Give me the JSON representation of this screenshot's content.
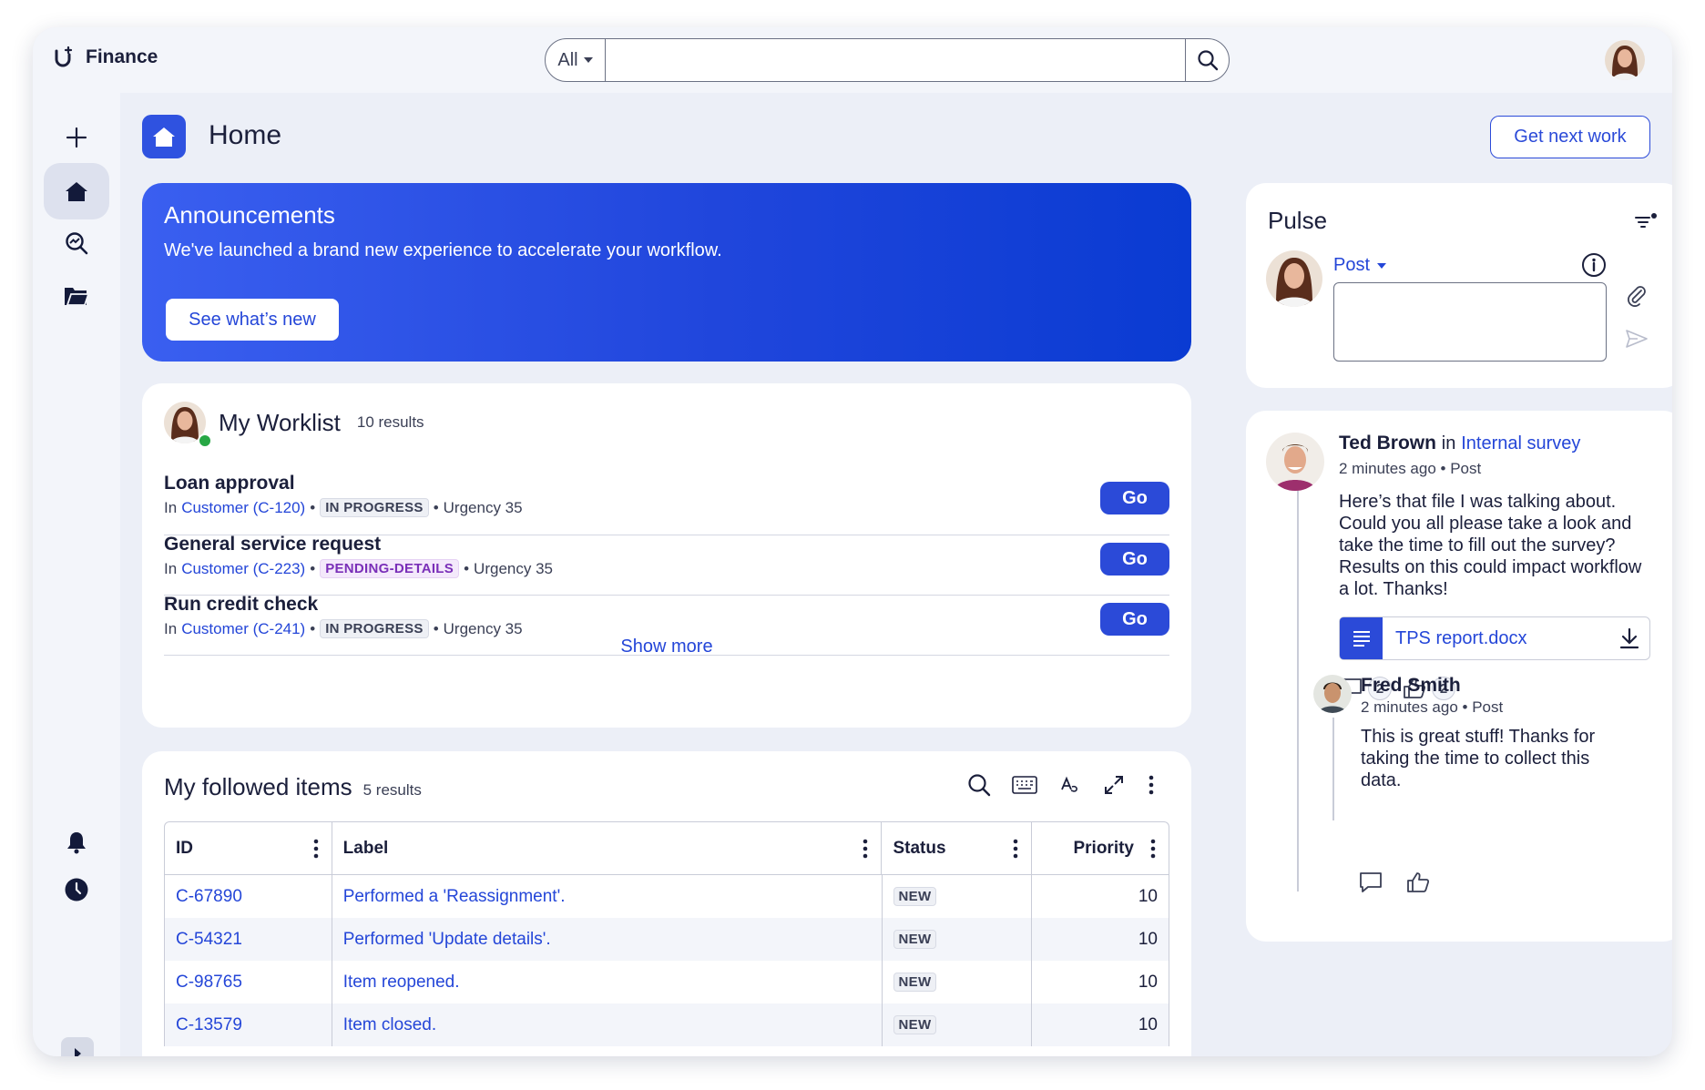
{
  "app": {
    "name": "Finance"
  },
  "search": {
    "scope": "All",
    "value": "",
    "placeholder": ""
  },
  "page": {
    "title": "Home",
    "action_label": "Get next work"
  },
  "announcement": {
    "title": "Announcements",
    "text": "We've launched a brand new experience to accelerate your workflow.",
    "button": "See what’s new"
  },
  "worklist": {
    "title": "My Worklist",
    "count": "10 results",
    "items": [
      {
        "title": "Loan approval",
        "prefix": "In",
        "ref": "Customer (C-120)",
        "status": "IN PROGRESS",
        "urgency": "Urgency 35",
        "action": "Go"
      },
      {
        "title": "General service request",
        "prefix": "In",
        "ref": "Customer (C-223)",
        "status": "PENDING-DETAILS",
        "urgency": "Urgency 35",
        "action": "Go"
      },
      {
        "title": "Run credit check",
        "prefix": "In",
        "ref": "Customer (C-241)",
        "status": "IN PROGRESS",
        "urgency": "Urgency 35",
        "action": "Go"
      }
    ],
    "show_more": "Show more"
  },
  "followed": {
    "title": "My followed items",
    "count": "5 results",
    "columns": [
      "ID",
      "Label",
      "Status",
      "Priority"
    ],
    "rows": [
      {
        "id": "C-67890",
        "label": "Performed a 'Reassignment'.",
        "status": "NEW",
        "priority": "10"
      },
      {
        "id": "C-54321",
        "label": "Performed 'Update details'.",
        "status": "NEW",
        "priority": "10"
      },
      {
        "id": "C-98765",
        "label": "Item reopened.",
        "status": "NEW",
        "priority": "10"
      },
      {
        "id": "C-13579",
        "label": "Item closed.",
        "status": "NEW",
        "priority": "10"
      }
    ]
  },
  "pulse": {
    "title": "Pulse",
    "post_type": "Post",
    "post_value": ""
  },
  "feed": {
    "post": {
      "author": "Ted Brown",
      "in": "in",
      "channel": "Internal survey",
      "meta": "2 minutes ago • Post",
      "body": "Here’s that file I was talking about. Could you all please take a look and take the time to fill out the survey? Results on this could impact workflow a lot. Thanks!",
      "attachment": "TPS report.docx",
      "comment_count": "2",
      "like_count": "2"
    },
    "reply": {
      "author": "Fred Smith",
      "meta": "2 minutes ago • Post",
      "body": "This is great stuff! Thanks for taking the time to collect this data."
    }
  },
  "colors": {
    "accent": "#2b4ad8",
    "pending": "#7a2fb8",
    "online": "#27a744"
  }
}
